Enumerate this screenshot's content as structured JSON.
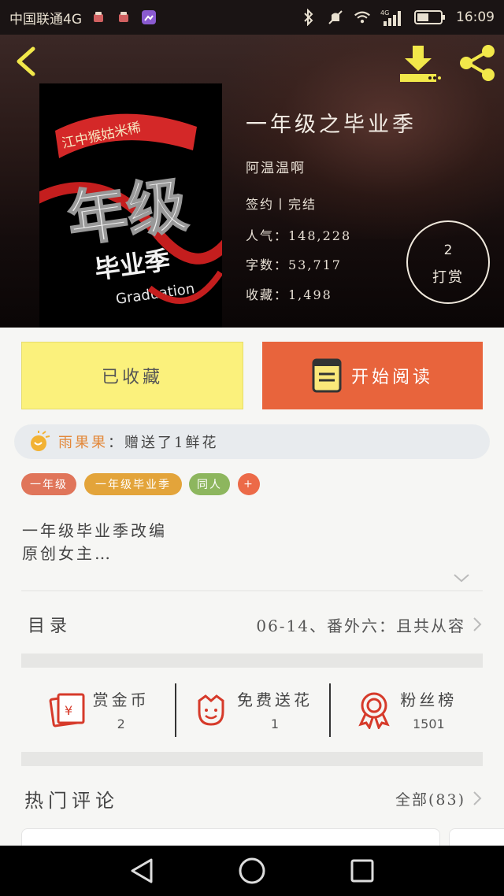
{
  "status_bar": {
    "carrier": "中国联通4G",
    "network": "4G",
    "time": "16:09"
  },
  "header": {
    "back_icon": "back-arrow-icon",
    "download_icon": "download-icon",
    "share_icon": "share-icon"
  },
  "book": {
    "title": "一年级之毕业季",
    "author": "阿温温啊",
    "status": "签约丨完结",
    "popularity": "人气：148,228",
    "word_count": "字数：53,717",
    "favorites": "收藏：1,498",
    "cover_text": {
      "banner": "江中猴姑米稀",
      "main": "年级",
      "sub": "毕业季",
      "en": "Graduation"
    }
  },
  "tip": {
    "count": "2",
    "label": "打赏"
  },
  "actions": {
    "collected_label": "已收藏",
    "read_label": "开始阅读"
  },
  "gift_notice": {
    "user": "雨果果",
    "text": "：赠送了1鲜花"
  },
  "tags": [
    {
      "label": "一年级",
      "color": "#e0755a"
    },
    {
      "label": "一年级毕业季",
      "color": "#e3a43a"
    },
    {
      "label": "同人",
      "color": "#8db65e"
    },
    {
      "label": "+",
      "color": "#ec6a48"
    }
  ],
  "description": {
    "line1": "一年级毕业季改编",
    "line2": "原创女主…"
  },
  "toc": {
    "label": "目录",
    "latest": "06-14、番外六：且共从容"
  },
  "stats": {
    "coins": {
      "label": "赏金币",
      "value": "2"
    },
    "flowers": {
      "label": "免费送花",
      "value": "1"
    },
    "fans": {
      "label": "粉丝榜",
      "value": "1501"
    }
  },
  "hot_comments": {
    "label": "热门评论",
    "all": "全部(83)"
  },
  "colors": {
    "accent_orange": "#e8643c",
    "collected_yellow": "#fbf17c",
    "icon_red": "#d63a2a",
    "icon_yellow": "#f2e84a"
  }
}
